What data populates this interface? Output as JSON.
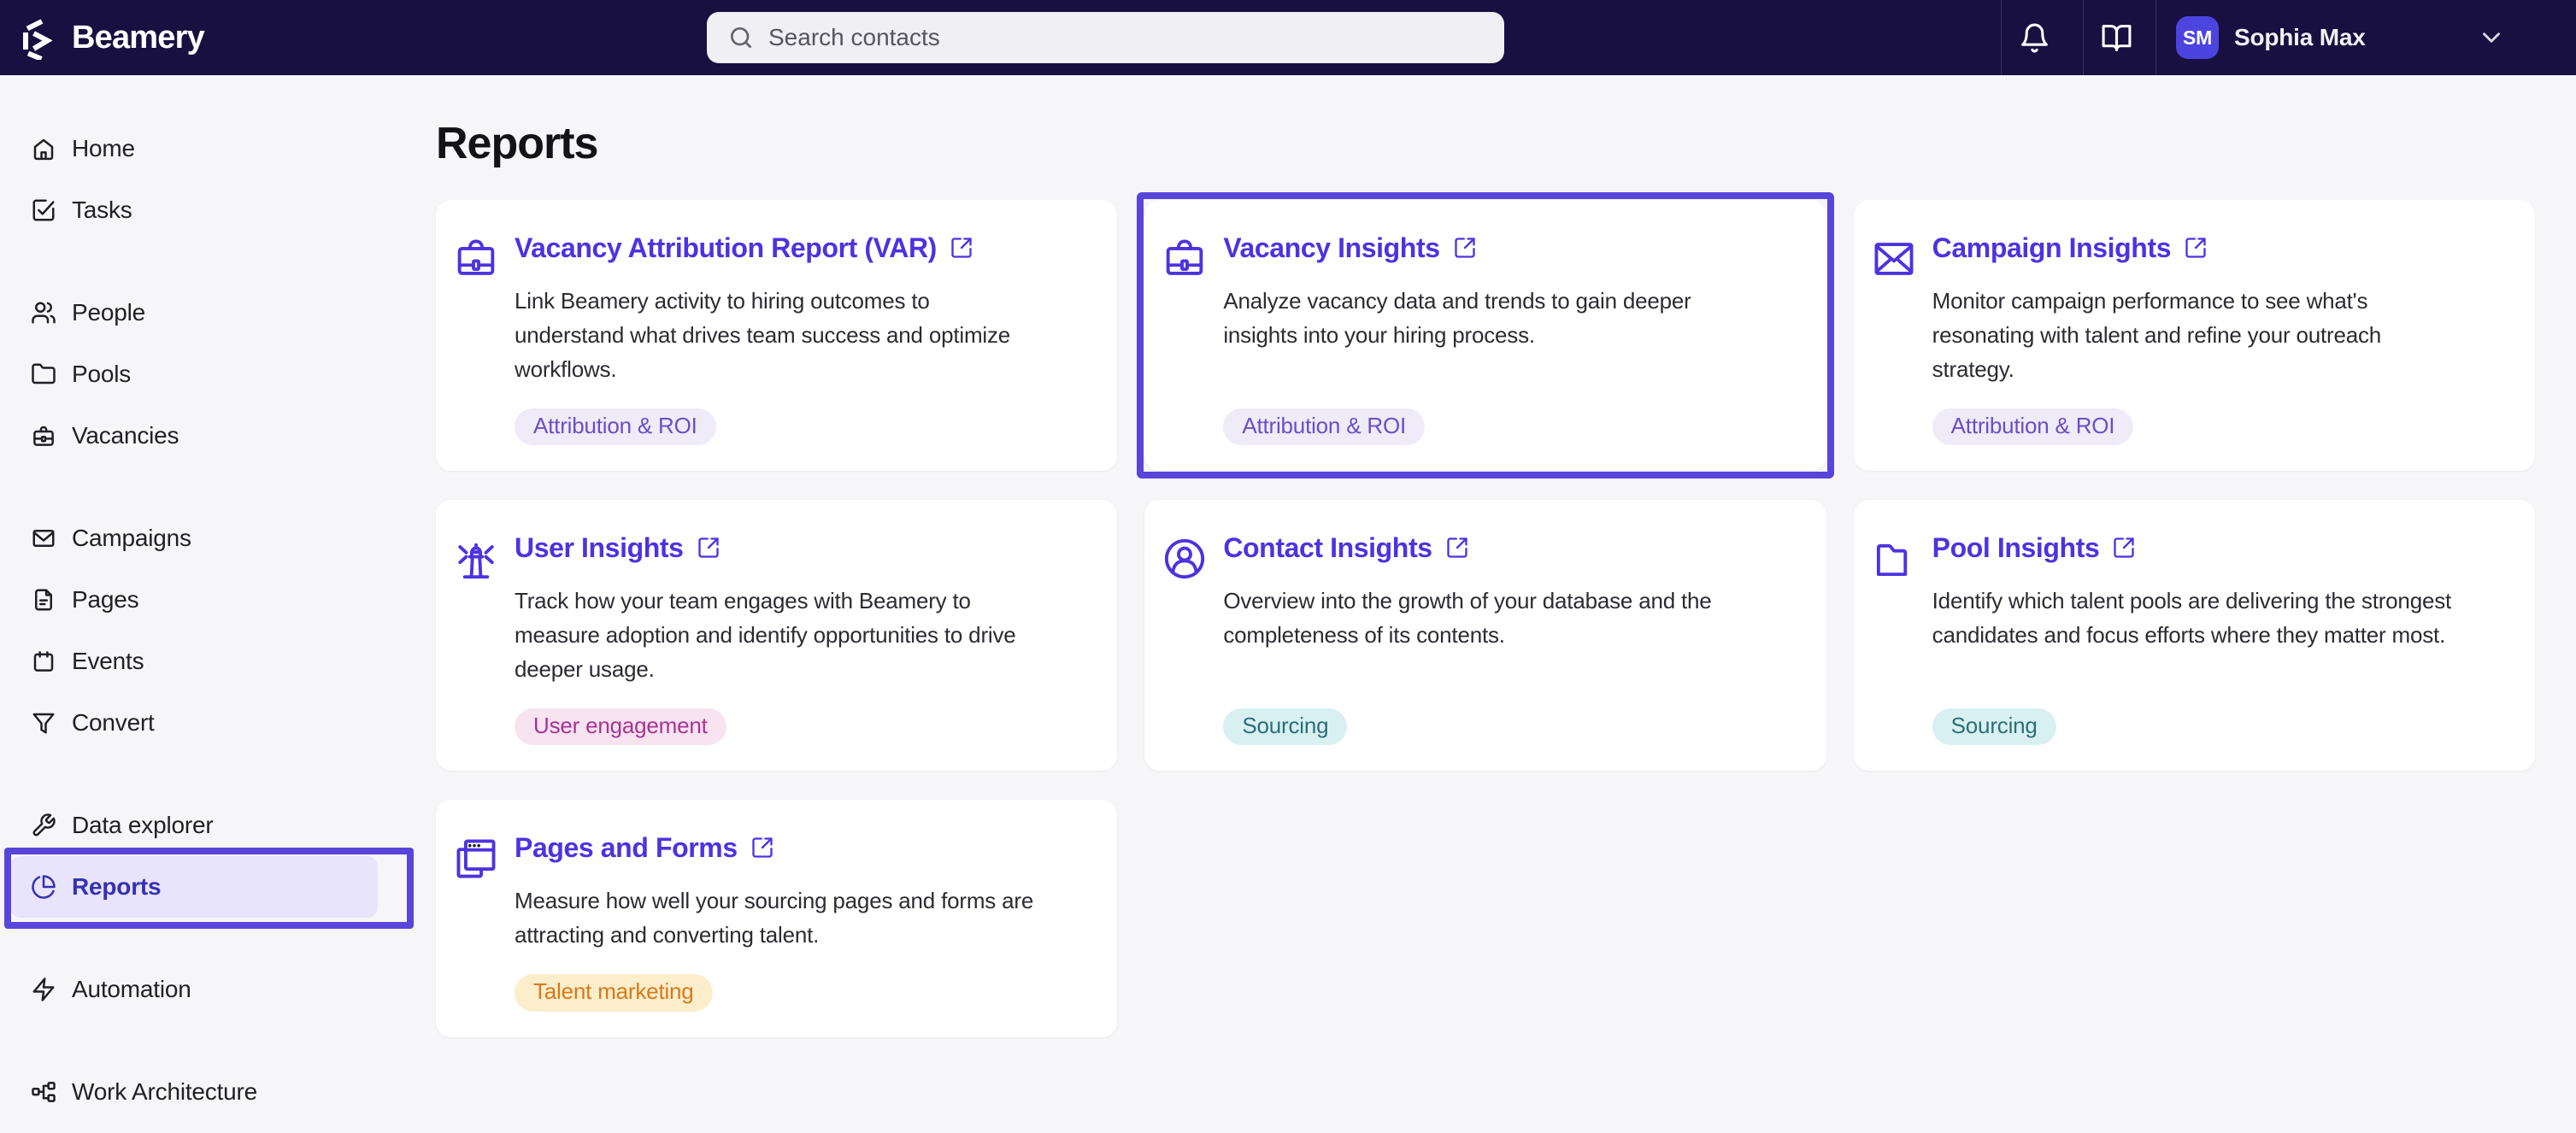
{
  "topbar": {
    "brand": "Beamery",
    "search_placeholder": "Search contacts",
    "user": {
      "initials": "SM",
      "name": "Sophia Max"
    }
  },
  "sidebar": {
    "items": [
      {
        "label": "Home",
        "icon": "home"
      },
      {
        "label": "Tasks",
        "icon": "tasks"
      },
      {
        "label": "People",
        "icon": "people"
      },
      {
        "label": "Pools",
        "icon": "pools"
      },
      {
        "label": "Vacancies",
        "icon": "vacancies"
      },
      {
        "label": "Campaigns",
        "icon": "campaigns"
      },
      {
        "label": "Pages",
        "icon": "pages"
      },
      {
        "label": "Events",
        "icon": "events"
      },
      {
        "label": "Convert",
        "icon": "convert"
      },
      {
        "label": "Data explorer",
        "icon": "data-explorer"
      },
      {
        "label": "Reports",
        "icon": "reports",
        "active": true
      },
      {
        "label": "Automation",
        "icon": "automation"
      },
      {
        "label": "Work Architecture",
        "icon": "work-architecture"
      }
    ]
  },
  "page": {
    "title": "Reports"
  },
  "cards": [
    {
      "title": "Vacancy Attribution Report (VAR)",
      "icon": "briefcase",
      "desc": "Link Beamery activity to hiring outcomes to\nunderstand what drives team success and optimize\nworkflows.",
      "badge": {
        "label": "Attribution & ROI",
        "bg": "#EFEBF8",
        "fg": "#6B4EC5"
      },
      "highlighted": false
    },
    {
      "title": "Vacancy Insights",
      "icon": "briefcase",
      "desc": "Analyze vacancy data and trends to gain deeper\ninsights into your hiring process.",
      "badge": {
        "label": "Attribution & ROI",
        "bg": "#EFEBF8",
        "fg": "#6B4EC5"
      },
      "highlighted": true
    },
    {
      "title": "Campaign Insights",
      "icon": "envelope",
      "desc": "Monitor campaign performance to see what's\nresonating with talent and refine your outreach\nstrategy.",
      "badge": {
        "label": "Attribution & ROI",
        "bg": "#EFEBF8",
        "fg": "#6B4EC5"
      },
      "highlighted": false
    },
    {
      "title": "User Insights",
      "icon": "lighthouse",
      "desc": "Track how your team engages with Beamery to\nmeasure adoption and identify opportunities to drive\ndeeper usage.",
      "badge": {
        "label": "User engagement",
        "bg": "#F8E3F1",
        "fg": "#A93395"
      },
      "highlighted": false
    },
    {
      "title": "Contact Insights",
      "icon": "contact",
      "desc": "Overview into the growth of your database and the\ncompleteness of its contents.",
      "badge": {
        "label": "Sourcing",
        "bg": "#D9F0F3",
        "fg": "#2A6F77"
      },
      "highlighted": false
    },
    {
      "title": "Pool Insights",
      "icon": "folder",
      "desc": "Identify which talent pools are delivering the strongest\ncandidates and focus efforts where they matter most.",
      "badge": {
        "label": "Sourcing",
        "bg": "#D9F0F3",
        "fg": "#2A6F77"
      },
      "highlighted": false
    },
    {
      "title": "Pages and Forms",
      "icon": "browser",
      "desc": "Measure how well your sourcing pages and forms are\nattracting and converting talent.",
      "badge": {
        "label": "Talent marketing",
        "bg": "#FCEECB",
        "fg": "#D9781A"
      },
      "highlighted": false
    }
  ],
  "colors": {
    "topbar_bg": "#171040",
    "accent_purple": "#4C33E0",
    "annotation_purple": "#5845DA",
    "active_pill_bg": "#E8E4FB",
    "active_text": "#3530B3",
    "avatar_bg": "#4D44E0",
    "page_bg": "#F6F6F8"
  }
}
